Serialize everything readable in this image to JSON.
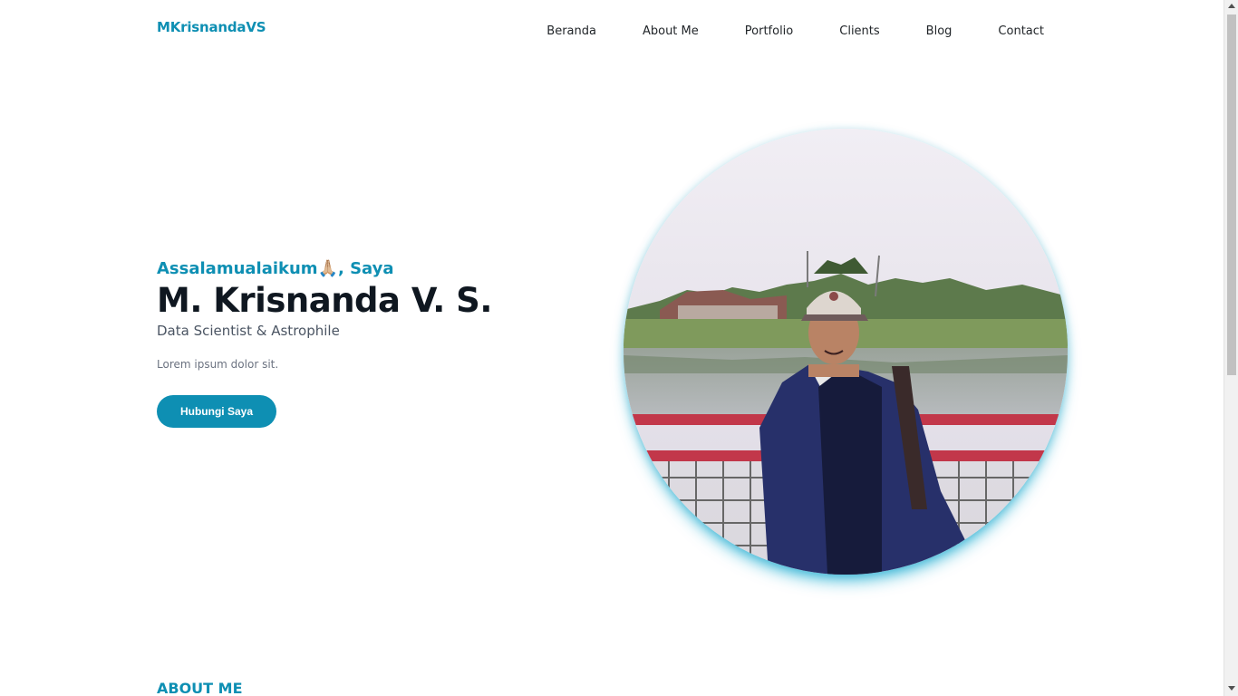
{
  "navbar": {
    "brand": "MKrisnandaVS",
    "links": [
      "Beranda",
      "About Me",
      "Portfolio",
      "Clients",
      "Blog",
      "Contact"
    ]
  },
  "hero": {
    "greeting": "Assalamualaikum🙏🏼, Saya",
    "name": "M. Krisnanda V. S.",
    "role": "Data Scientist & Astrophile",
    "description": "Lorem ipsum dolor sit.",
    "cta_label": "Hubungi Saya"
  },
  "about": {
    "heading": "ABOUT ME"
  },
  "colors": {
    "accent": "#0e8fb3",
    "text_dark": "#0f1720",
    "text_muted": "#6b7280"
  }
}
